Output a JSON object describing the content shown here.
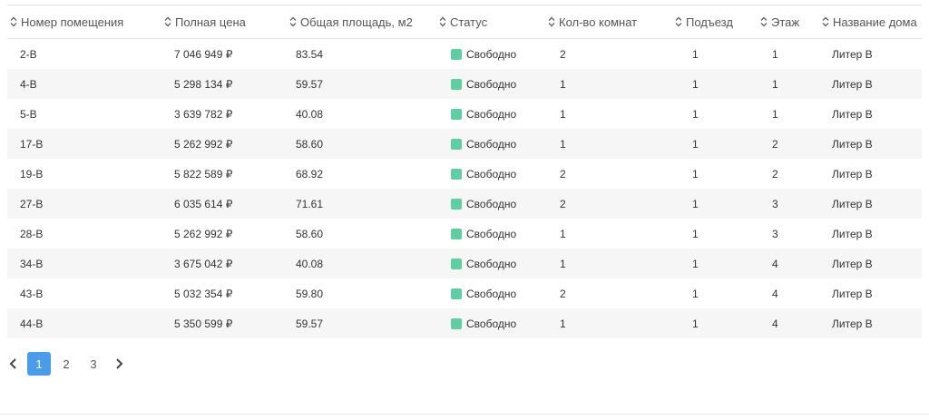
{
  "colors": {
    "status_free": "#5fcfa1",
    "active_page": "#4a9be8",
    "row_alt": "#f6f6f6"
  },
  "headers": [
    {
      "label": "Номер помещения",
      "icon": "sort-icon"
    },
    {
      "label": "Полная цена",
      "icon": "sort-icon"
    },
    {
      "label": "Общая площадь, м2",
      "icon": "sort-icon"
    },
    {
      "label": "Статус",
      "icon": "sort-icon"
    },
    {
      "label": "Кол-во комнат",
      "icon": "sort-icon"
    },
    {
      "label": "Подъезд",
      "icon": "sort-icon"
    },
    {
      "label": "Этаж",
      "icon": "sort-icon"
    },
    {
      "label": "Название дома",
      "icon": "sort-icon"
    }
  ],
  "rows": [
    {
      "number": "2-В",
      "price": "7 046 949 ₽",
      "area": "83.54",
      "status": "Свободно",
      "rooms": "2",
      "entrance": "1",
      "floor": "1",
      "house": "Литер В"
    },
    {
      "number": "4-В",
      "price": "5 298 134 ₽",
      "area": "59.57",
      "status": "Свободно",
      "rooms": "1",
      "entrance": "1",
      "floor": "1",
      "house": "Литер В"
    },
    {
      "number": "5-В",
      "price": "3 639 782 ₽",
      "area": "40.08",
      "status": "Свободно",
      "rooms": "1",
      "entrance": "1",
      "floor": "1",
      "house": "Литер В"
    },
    {
      "number": "17-В",
      "price": "5 262 992 ₽",
      "area": "58.60",
      "status": "Свободно",
      "rooms": "1",
      "entrance": "1",
      "floor": "2",
      "house": "Литер В"
    },
    {
      "number": "19-В",
      "price": "5 822 589 ₽",
      "area": "68.92",
      "status": "Свободно",
      "rooms": "2",
      "entrance": "1",
      "floor": "2",
      "house": "Литер В"
    },
    {
      "number": "27-В",
      "price": "6 035 614 ₽",
      "area": "71.61",
      "status": "Свободно",
      "rooms": "2",
      "entrance": "1",
      "floor": "3",
      "house": "Литер В"
    },
    {
      "number": "28-В",
      "price": "5 262 992 ₽",
      "area": "58.60",
      "status": "Свободно",
      "rooms": "1",
      "entrance": "1",
      "floor": "3",
      "house": "Литер В"
    },
    {
      "number": "34-В",
      "price": "3 675 042 ₽",
      "area": "40.08",
      "status": "Свободно",
      "rooms": "1",
      "entrance": "1",
      "floor": "4",
      "house": "Литер В"
    },
    {
      "number": "43-В",
      "price": "5 032 354 ₽",
      "area": "59.80",
      "status": "Свободно",
      "rooms": "2",
      "entrance": "1",
      "floor": "4",
      "house": "Литер В"
    },
    {
      "number": "44-В",
      "price": "5 350 599 ₽",
      "area": "59.57",
      "status": "Свободно",
      "rooms": "1",
      "entrance": "1",
      "floor": "4",
      "house": "Литер В"
    }
  ],
  "pagination": {
    "prev_icon": "chevron-left-icon",
    "next_icon": "chevron-right-icon",
    "pages": [
      "1",
      "2",
      "3"
    ],
    "active": "1"
  }
}
